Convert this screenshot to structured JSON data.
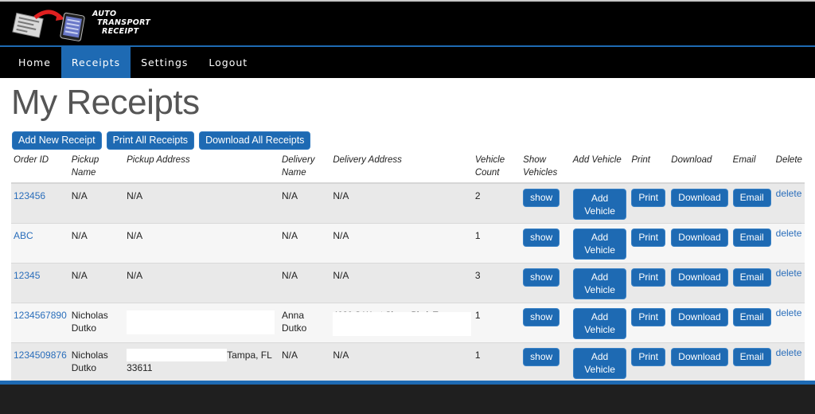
{
  "app": {
    "logo_lines": [
      "Auto",
      "Transport",
      "Receipt"
    ]
  },
  "nav": {
    "items": [
      {
        "label": "Home",
        "active": false
      },
      {
        "label": "Receipts",
        "active": true
      },
      {
        "label": "Settings",
        "active": false
      },
      {
        "label": "Logout",
        "active": false
      }
    ]
  },
  "page": {
    "title": "My Receipts"
  },
  "actions": {
    "add_new": "Add New Receipt",
    "print_all": "Print All Receipts",
    "download_all": "Download All Receipts"
  },
  "table": {
    "headers": {
      "order_id": "Order ID",
      "pickup_name": "Pickup Name",
      "pickup_address": "Pickup Address",
      "delivery_name": "Delivery Name",
      "delivery_address": "Delivery Address",
      "vehicle_count": "Vehicle Count",
      "show_vehicles": "Show Vehicles",
      "add_vehicle": "Add Vehicle",
      "print": "Print",
      "download": "Download",
      "email": "Email",
      "delete": "Delete"
    },
    "button_labels": {
      "show": "show",
      "add_vehicle": "Add Vehicle",
      "print": "Print",
      "download": "Download",
      "email": "Email",
      "delete": "delete"
    },
    "rows": [
      {
        "order_id": "123456",
        "pickup_name": "N/A",
        "pickup_address": "N/A",
        "delivery_name": "N/A",
        "delivery_address": "N/A",
        "vehicle_count": "2"
      },
      {
        "order_id": "ABC",
        "pickup_name": "N/A",
        "pickup_address": "N/A",
        "delivery_name": "N/A",
        "delivery_address": "N/A",
        "vehicle_count": "1"
      },
      {
        "order_id": "12345",
        "pickup_name": "N/A",
        "pickup_address": "N/A",
        "delivery_name": "N/A",
        "delivery_address": "N/A",
        "vehicle_count": "3"
      },
      {
        "order_id": "1234567890",
        "pickup_name": "Nicholas Dutko",
        "pickup_address": "[redacted]",
        "delivery_name": "Anna Dutko",
        "delivery_address": "4020 S West Shore Blvd, Tampa [partially redacted]",
        "vehicle_count": "1"
      },
      {
        "order_id": "1234509876",
        "pickup_name": "Nicholas Dutko",
        "pickup_address": "[redacted] Tampa, FL 33611",
        "delivery_name": "N/A",
        "delivery_address": "N/A",
        "vehicle_count": "1"
      }
    ],
    "row4_delivery_visible_fragment": "4020 S West Shore Blvd, Tampa",
    "row5_pickup_visible_suffix": "Tampa, FL",
    "row5_pickup_visible_line2": "33611"
  },
  "colors": {
    "brand_blue": "#1e6ab3",
    "link_blue": "#2a6ebb",
    "header_bg": "#000000",
    "footer_bg": "#1f1f1f"
  }
}
